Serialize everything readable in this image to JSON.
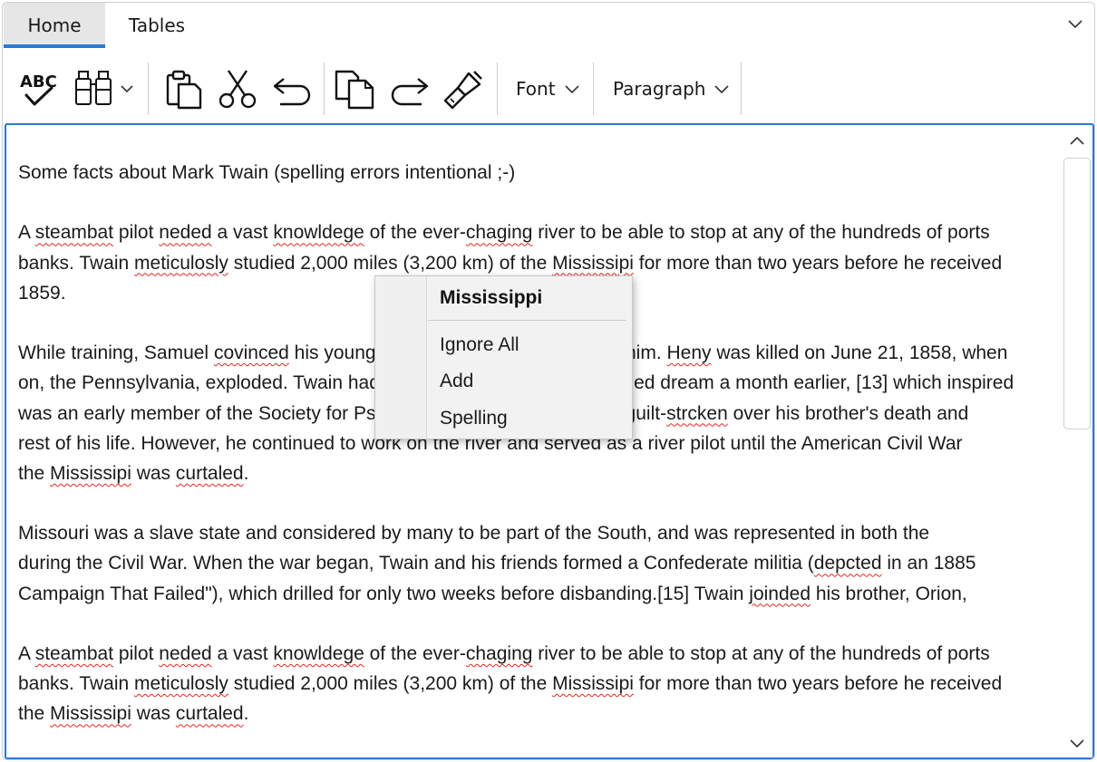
{
  "tabs": [
    {
      "label": "Home",
      "active": true
    },
    {
      "label": "Tables",
      "active": false
    }
  ],
  "toolbar": {
    "icons": [
      "spellcheck-icon",
      "find-binoculars-icon",
      "paste-icon",
      "cut-icon",
      "undo-icon",
      "copy-icon",
      "redo-icon",
      "format-painter-icon"
    ],
    "font_label": "Font",
    "paragraph_label": "Paragraph"
  },
  "colors": {
    "accent": "#2b79d6",
    "spelling_error": "#e0281f",
    "tab_active_bg": "#e6e6e6",
    "menu_bg": "#f2f2f2"
  },
  "document": {
    "paragraphs": [
      [
        [
          {
            "t": "Some facts about Mark Twain (spelling errors intentional ;-)"
          }
        ]
      ],
      [
        [
          {
            "t": "A "
          },
          {
            "t": "steambat",
            "err": true
          },
          {
            "t": " pilot "
          },
          {
            "t": "neded",
            "err": true
          },
          {
            "t": " a vast "
          },
          {
            "t": "knowldege",
            "err": true
          },
          {
            "t": " of the ever-"
          },
          {
            "t": "chaging",
            "err": true
          },
          {
            "t": " river to be able to stop at any of the hundreds of ports"
          }
        ],
        [
          {
            "t": "banks. Twain "
          },
          {
            "t": "meticulosly",
            "err": true
          },
          {
            "t": " studied 2,000 miles (3,200 km) of the "
          },
          {
            "t": "Mississipi",
            "err": true
          },
          {
            "t": " for more than two years before he received"
          }
        ],
        [
          {
            "t": "1859."
          }
        ]
      ],
      [
        [
          {
            "t": "While training, Samuel "
          },
          {
            "t": "covinced",
            "err": true
          },
          {
            "t": " his younger brother Henry to work with him. "
          },
          {
            "t": "Heny",
            "err": true
          },
          {
            "t": " was killed on June 21, 1858, when"
          }
        ],
        [
          {
            "t": "on, the Pennsylvania, exploded. Twain had foreseen this death in a detailed dream a month earlier, [13] which inspired"
          }
        ],
        [
          {
            "t": "was an early member of the Society for Psychical Research. Twain was guilt-"
          },
          {
            "t": "strcken",
            "err": true
          },
          {
            "t": " over his brother's death and"
          }
        ],
        [
          {
            "t": "rest of his life. However, he continued to work on the river and served as a river pilot until the American Civil War"
          }
        ],
        [
          {
            "t": "the "
          },
          {
            "t": "Mississipi",
            "err": true
          },
          {
            "t": " was "
          },
          {
            "t": "curtaled",
            "err": true
          },
          {
            "t": "."
          }
        ]
      ],
      [
        [
          {
            "t": "Missouri was a slave state and considered by many to be part of the South, and was represented in both the"
          }
        ],
        [
          {
            "t": "during the Civil War. When the war began, Twain and his friends formed a Confederate militia ("
          },
          {
            "t": "depcted",
            "err": true
          },
          {
            "t": " in an 1885"
          }
        ],
        [
          {
            "t": "Campaign That Failed\"), which drilled for only two weeks before disbanding.[15] Twain "
          },
          {
            "t": "joinded",
            "err": true
          },
          {
            "t": " his brother, Orion,"
          }
        ]
      ],
      [
        [
          {
            "t": "A "
          },
          {
            "t": "steambat",
            "err": true
          },
          {
            "t": " pilot "
          },
          {
            "t": "neded",
            "err": true
          },
          {
            "t": " a vast "
          },
          {
            "t": "knowldege",
            "err": true
          },
          {
            "t": " of the ever-"
          },
          {
            "t": "chaging",
            "err": true
          },
          {
            "t": " river to be able to stop at any of the hundreds of ports"
          }
        ],
        [
          {
            "t": "banks. Twain "
          },
          {
            "t": "meticulosly",
            "err": true
          },
          {
            "t": " studied 2,000 miles (3,200 km) of the "
          },
          {
            "t": "Mississipi",
            "err": true
          },
          {
            "t": " for more than two years before he received"
          }
        ],
        [
          {
            "t": "the "
          },
          {
            "t": "Mississipi",
            "err": true
          },
          {
            "t": " was "
          },
          {
            "t": "curtaled",
            "err": true
          },
          {
            "t": "."
          }
        ]
      ]
    ]
  },
  "context_menu": {
    "suggestion": "Mississippi",
    "items": [
      "Ignore All",
      "Add",
      "Spelling"
    ]
  }
}
